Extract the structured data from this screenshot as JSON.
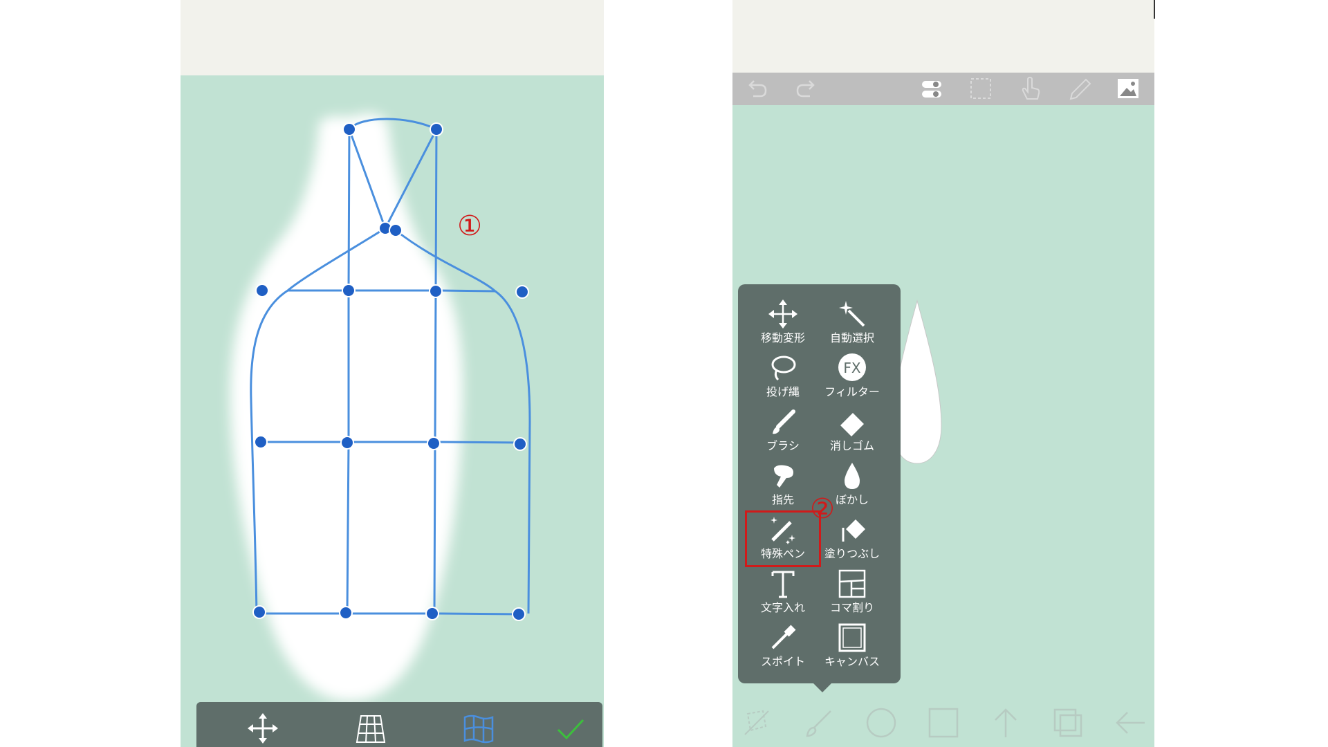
{
  "annotations": {
    "marker_1": "①",
    "marker_2": "②"
  },
  "left_panel": {
    "transform_toolbar": {
      "icons": [
        "move-icon",
        "perspective-grid-icon",
        "mesh-warp-icon",
        "checkmark-icon"
      ]
    }
  },
  "right_panel": {
    "top_toolbar": {
      "icons": [
        "undo-icon",
        "redo-icon",
        "toggle-icon",
        "selection-icon",
        "touch-icon",
        "pen-icon",
        "image-icon"
      ]
    },
    "tool_menu": {
      "items": [
        {
          "label": "移動変形",
          "icon": "move-transform-icon"
        },
        {
          "label": "自動選択",
          "icon": "magic-wand-icon"
        },
        {
          "label": "投げ縄",
          "icon": "lasso-icon"
        },
        {
          "label": "フィルター",
          "icon": "fx-filter-icon"
        },
        {
          "label": "ブラシ",
          "icon": "brush-icon"
        },
        {
          "label": "消しゴム",
          "icon": "eraser-icon"
        },
        {
          "label": "指先",
          "icon": "finger-smudge-icon"
        },
        {
          "label": "ぼかし",
          "icon": "blur-drop-icon"
        },
        {
          "label": "特殊ペン",
          "icon": "special-pen-icon"
        },
        {
          "label": "塗りつぶし",
          "icon": "fill-bucket-icon"
        },
        {
          "label": "文字入れ",
          "icon": "text-icon"
        },
        {
          "label": "コマ割り",
          "icon": "panel-layout-icon"
        },
        {
          "label": "スポイト",
          "icon": "eyedropper-icon"
        },
        {
          "label": "キャンバス",
          "icon": "canvas-icon"
        }
      ],
      "highlighted": "特殊ペン"
    },
    "bottom_toolbar": {
      "icons": [
        "transform-tool-icon",
        "brush-tool-icon",
        "circle-icon",
        "square-icon",
        "arrow-up-icon",
        "layers-icon",
        "back-arrow-icon"
      ]
    }
  },
  "colors": {
    "canvas_bg": "#c1e2d3",
    "topbar_bg": "#f2f2ec",
    "toolbar_gray": "#bebebe",
    "panel_dark": "#5f6e6a",
    "mesh_blue": "#4a8fde",
    "node_blue": "#1f5fc4",
    "accent_red": "#d11a1a",
    "check_green": "#3cc03c"
  }
}
